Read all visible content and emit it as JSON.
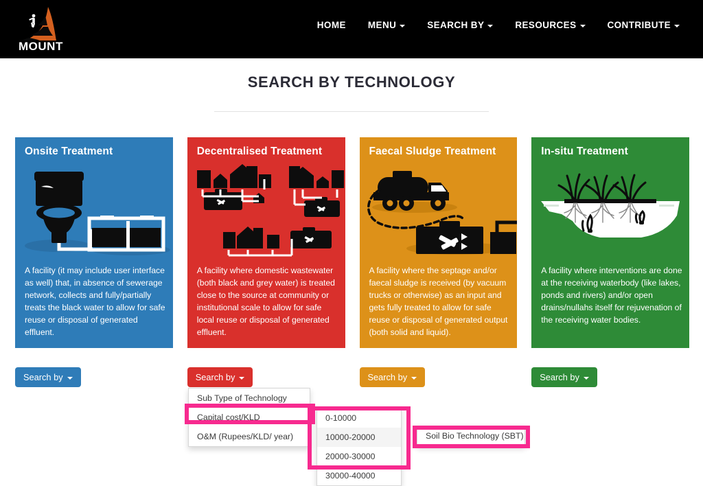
{
  "header": {
    "logo_text": "MOUNT",
    "logo_icon": "mountain-climber-logo",
    "nav": [
      {
        "label": "HOME",
        "has_caret": false
      },
      {
        "label": "MENU",
        "has_caret": true
      },
      {
        "label": "SEARCH BY",
        "has_caret": true
      },
      {
        "label": "RESOURCES",
        "has_caret": true
      },
      {
        "label": "CONTRIBUTE",
        "has_caret": true
      }
    ]
  },
  "page": {
    "title": "SEARCH BY TECHNOLOGY"
  },
  "cards": [
    {
      "title": "Onsite Treatment",
      "color": "#2e7cb8",
      "art": "toilet-and-septic-tank-illustration",
      "description": "A facility (it may include user interface as well) that, in absence of sewerage network, collects and fully/partially treats the black water to allow for safe reuse or disposal of generated effluent.",
      "button_label": "Search by"
    },
    {
      "title": "Decentralised Treatment",
      "color": "#d9302c",
      "art": "buildings-connected-to-treatment-units-illustration",
      "description": "A facility where domestic wastewater (both black and grey water) is treated close to the source at community or institutional scale to allow for safe local reuse or disposal of generated effluent.",
      "button_label": "Search by"
    },
    {
      "title": "Faecal Sludge Treatment",
      "color": "#dd9119",
      "art": "vacuum-truck-and-treatment-plant-illustration",
      "description": "A facility where the septage and/or faecal sludge is received (by vacuum trucks or otherwise) as an input and gets fully treated to allow for safe reuse or disposal of generated output (both solid and liquid).",
      "button_label": "Search by"
    },
    {
      "title": "In-situ Treatment",
      "color": "#2e8b37",
      "art": "waterbody-cross-section-with-reeds-illustration",
      "description": "A facility where interventions are done at the receiving waterbody (like lakes, ponds and rivers) and/or open drains/nullahs itself for rejuvenation of the receiving water bodies.",
      "button_label": "Search by"
    }
  ],
  "dropdown_level1": {
    "items": [
      {
        "label": "Sub Type of Technology",
        "highlighted": false
      },
      {
        "label": "Capital cost/KLD",
        "highlighted": true
      },
      {
        "label": "O&M (Rupees/KLD/ year)",
        "highlighted": false
      }
    ]
  },
  "dropdown_level2": {
    "items": [
      {
        "label": "0-10000",
        "hover": false
      },
      {
        "label": "10000-20000",
        "hover": true
      },
      {
        "label": "20000-30000",
        "hover": false
      },
      {
        "label": "30000-40000",
        "hover": false
      }
    ]
  },
  "dropdown_level3": {
    "items": [
      {
        "label": "Soil Bio Technology (SBT)",
        "hover": false
      }
    ]
  },
  "annotations": {
    "highlight_color": "#f72a8f"
  }
}
